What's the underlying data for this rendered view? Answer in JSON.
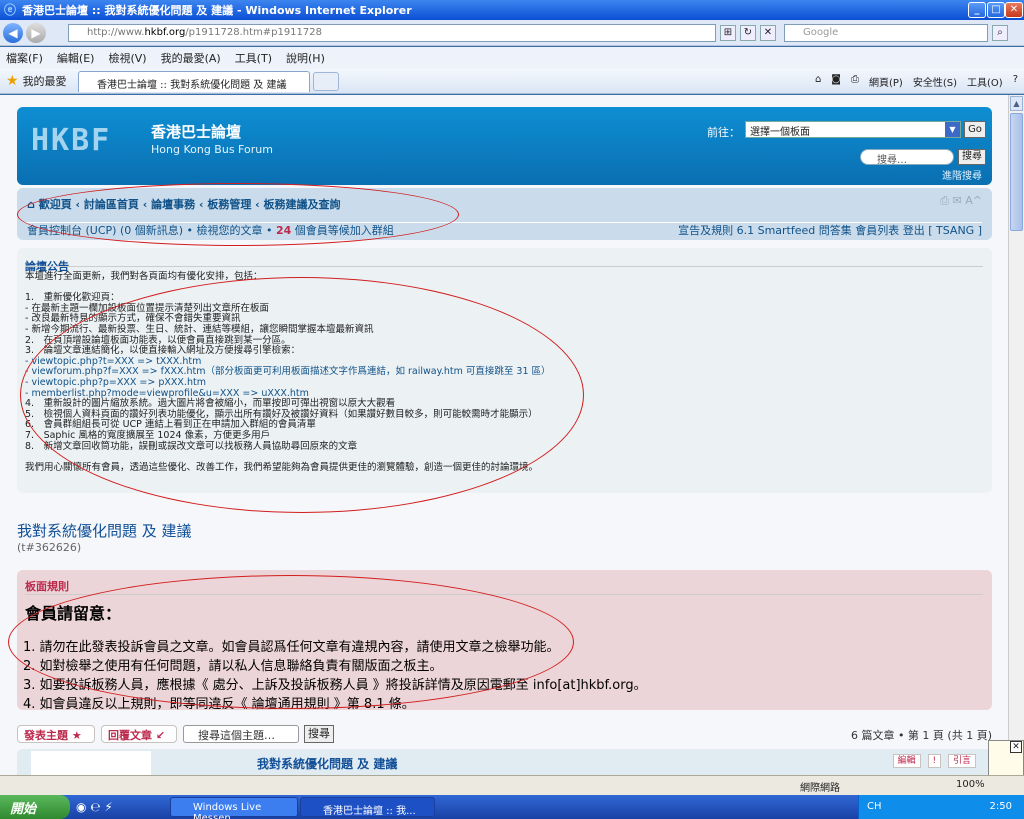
{
  "window": {
    "title": "香港巴士論壇 :: 我對系統優化問題 及 建議 - Windows Internet Explorer"
  },
  "browser": {
    "url_prefix": "http://www.",
    "url_domain": "hkbf.org",
    "url_path": "/p1911728.htm#p1911728",
    "search_placeholder": "Google",
    "menu": [
      "檔案(F)",
      "編輯(E)",
      "檢視(V)",
      "我的最愛(A)",
      "工具(T)",
      "說明(H)"
    ],
    "favorites_label": "我的最愛",
    "tab_title": "香港巴士論壇 :: 我對系統優化問題 及 建議",
    "cmd": [
      "網頁(P)",
      "安全性(S)",
      "工具(O)"
    ]
  },
  "header": {
    "logo_text": "HKBF",
    "site_title": "香港巴士論壇",
    "site_subtitle": "Hong Kong Bus Forum",
    "jump_label": "前往：",
    "jump_select": "選擇一個板面",
    "go_label": "Go",
    "search_placeholder": "搜尋…",
    "search_button": "搜尋",
    "advanced_search": "進階搜尋"
  },
  "navbar": {
    "breadcrumb": [
      "歡迎頁",
      "討論區首頁",
      "論壇事務",
      "板務管理",
      "板務建議及查詢"
    ],
    "ucp": "會員控制台 (UCP) (0 個新訊息) • 檢視您的文章 • ",
    "pending_count": "24",
    "pending_text": " 個會員等候加入群組",
    "right_links": "宣告及規則 6.1  Smartfeed  問答集  會員列表  登出 [ TSANG ]"
  },
  "announcement": {
    "title": "論壇公告",
    "intro": "本壇進行全面更新，我們對各頁面均有優化安排，包括：",
    "items": [
      "1.　重新優化歡迎頁：",
      "- 在最新主題一欄加設板面位置提示清楚列出文章所在板面",
      "- 改良最新特見的顯示方式，確保不會錯失重要資訊",
      "- 新增今期流行、最新投票、生日、統計、連結等模組，讓您瞬間掌握本壇最新資訊",
      "2.　在頁頂增設論壇板面功能表，以便會員直接跳到某一分區。",
      "3.　論壇文章連結簡化，以便直接輸入網址及方便搜尋引擎檢索：",
      "- viewtopic.php?t=XXX => tXXX.htm",
      "- viewforum.php?f=XXX => fXXX.htm（部分板面更可利用板面描述文字作爲連結，如 railway.htm 可直接跳至 31 區）",
      "- viewtopic.php?p=XXX => pXXX.htm",
      "- memberlist.php?mode=viewprofile&u=XXX => uXXX.htm",
      "4.　重新設計的圖片縮放系統。過大圖片將會被縮小，而單按即可彈出視窗以原大大觀看",
      "5.　檢視個人資料頁面的讚好列表功能優化，顯示出所有讚好及被讚好資料（如果讚好數目較多，則可能較需時才能顯示）",
      "6.　會員群組組長可從 UCP 連結上看到正在申請加入群組的會員清單",
      "7.　Saphic 風格的寬度擴展至 1024 像素，方便更多用戶",
      "8.　新增文章回收筒功能，誤刪或誤改文章可以找板務人員協助尋回原來的文章"
    ],
    "outro": "我們用心關懷所有會員，透過這些優化、改善工作，我們希望能夠為會員提供更佳的瀏覽體驗，創造一個更佳的討論環境。"
  },
  "topic": {
    "title": "我對系統優化問題 及 建議",
    "id": "(t#362626)"
  },
  "rules": {
    "title": "板面規則",
    "heading": "會員請留意：",
    "items": [
      "1.  請勿在此發表投訴會員之文章。如會員認爲任何文章有違規內容，請使用文章之檢舉功能。",
      "2.  如對檢舉之使用有任何問題，請以私人信息聯絡負責有關版面之板主。",
      "3.  如要投訴板務人員，應根據《 處分、上訴及投訴板務人員 》將投訴詳情及原因電郵至 info[at]hkbf.org。",
      "4.  如會員違反以上規則，即等同違反《 論壇通用規則 》第 8.1 條。"
    ]
  },
  "actions": {
    "new_topic": "發表主題",
    "reply": "回覆文章",
    "topic_search_placeholder": "搜尋這個主題…",
    "search_button": "搜尋",
    "pagination": "6 篇文章 • 第 1 頁 (共 1 頁)"
  },
  "post": {
    "title": "我對系統優化問題 及 建議",
    "edit": "編輯",
    "quote": "引言"
  },
  "status": {
    "zone": "網際網路",
    "zoom": "100%"
  },
  "taskbar": {
    "start": "開始",
    "items": [
      "Windows Live Messen...",
      "香港巴士論壇 :: 我..."
    ],
    "tray_lang": "CH",
    "clock": "2:50"
  }
}
